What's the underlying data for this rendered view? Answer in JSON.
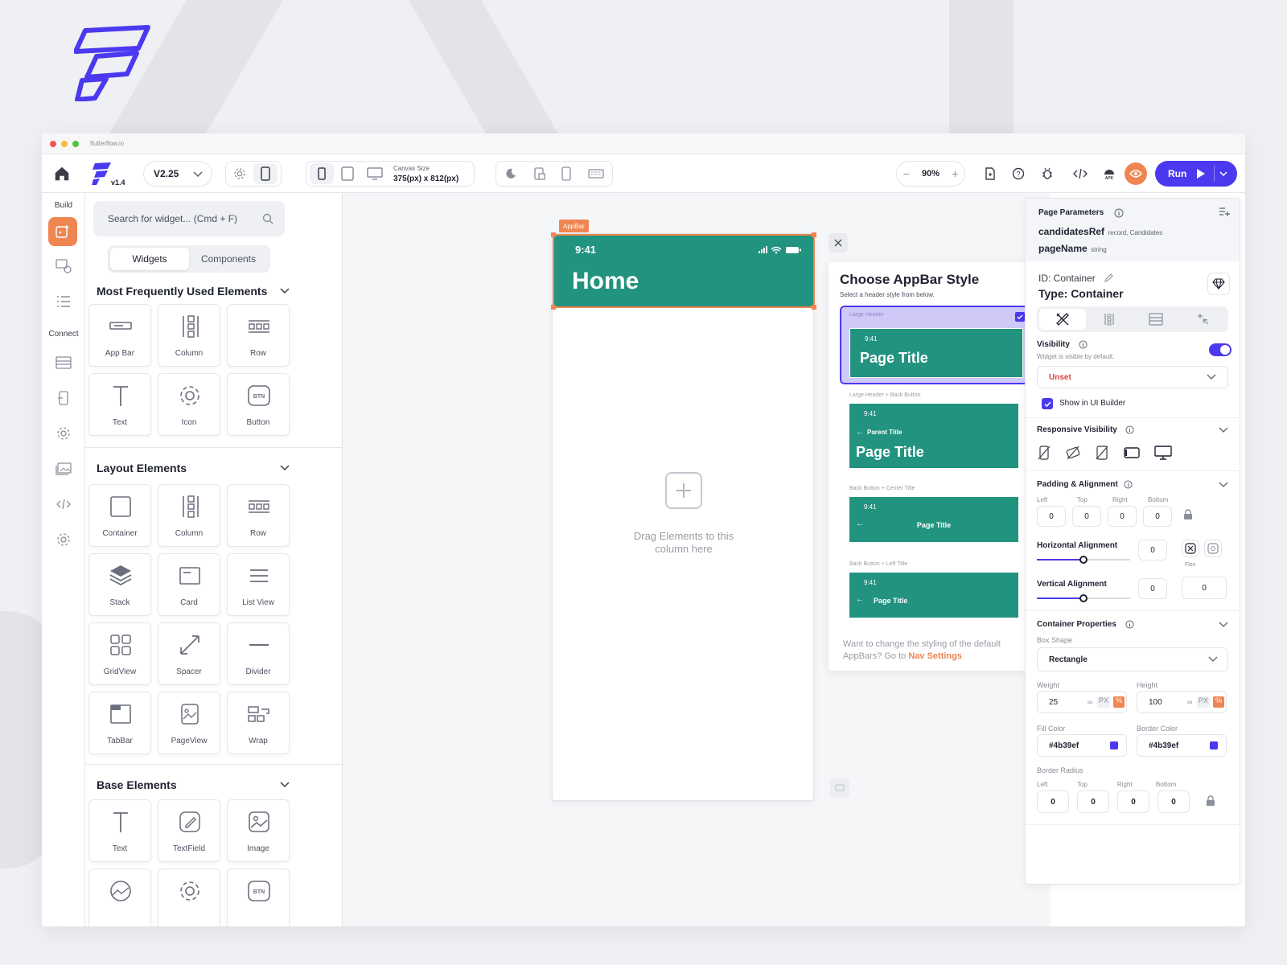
{
  "colors": {
    "brand": "#4b39ef",
    "accent": "#ef8551",
    "appbar": "#22937f",
    "selected_option": "#cfc9f7"
  },
  "browser": {
    "url": "flutterflow.io"
  },
  "toolbar": {
    "logo_version": "v1.4",
    "version": "V2.25",
    "canvas_size_label": "Canvas Size",
    "canvas_size_value": "375(px) x 812(px)",
    "zoom": "90%",
    "run_label": "Run"
  },
  "left_rail": {
    "build_label": "Build",
    "connect_label": "Connect"
  },
  "widget_panel": {
    "search_placeholder": "Search for widget... (Cmd + F)",
    "tabs": [
      "Widgets",
      "Components"
    ],
    "sections": [
      {
        "title": "Most Frequently Used Elements",
        "items": [
          "App Bar",
          "Column",
          "Row",
          "Text",
          "Icon",
          "Button"
        ]
      },
      {
        "title": "Layout Elements",
        "items": [
          "Container",
          "Column",
          "Row",
          "Stack",
          "Card",
          "List View",
          "GridView",
          "Spacer",
          "Divider",
          "TabBar",
          "PageView",
          "Wrap"
        ]
      },
      {
        "title": "Base Elements",
        "items": [
          "Text",
          "TextField",
          "Image"
        ]
      }
    ],
    "button_icon_text": "BTN"
  },
  "canvas": {
    "appbar_tag": "AppBar",
    "status_time": "9:41",
    "page_title": "Home",
    "drag_hint": "Drag Elements to this column here"
  },
  "appbar_chooser": {
    "title": "Choose AppBar Style",
    "subtitle": "Select a header style from below.",
    "options": [
      {
        "label": "Large Header",
        "time": "9:41",
        "title": "Page Title"
      },
      {
        "label": "Large Header + Back Button",
        "time": "9:41",
        "parent": "Parent Title",
        "title": "Page Title"
      },
      {
        "label": "Back Button + Center Title",
        "time": "9:41",
        "title": "Page Title"
      },
      {
        "label": "Back Button + Left Title",
        "time": "9:41",
        "title": "Page Title"
      }
    ],
    "footer_text": "Want to change the styling of the default AppBars? Go to",
    "footer_link": "Nav Settings"
  },
  "properties": {
    "page_params_title": "Page Parameters",
    "params": [
      {
        "name": "candidatesRef",
        "type": "record, Candidates"
      },
      {
        "name": "pageName",
        "type": "string"
      }
    ],
    "id_label": "ID: Container",
    "type_label": "Type: Container",
    "visibility_label": "Visibility",
    "visibility_hint": "Widget is visible by default.",
    "visibility_select": "Unset",
    "show_in_ui_builder": "Show in UI Builder",
    "responsive_visibility": "Responsive Visibility",
    "padding_title": "Padding & Alignment",
    "padding_labels": [
      "Left",
      "Top",
      "Right",
      "Bottom"
    ],
    "padding_values": [
      "0",
      "0",
      "0",
      "0"
    ],
    "horizontal_alignment": "Horizontal Alignment",
    "horizontal_value": "0",
    "flex_label": "Flex",
    "vertical_alignment": "Vertical Alignment",
    "vertical_value": "0",
    "flex_value": "0",
    "h_align_level": 0.5,
    "v_align_level": 0.5,
    "container_props_title": "Container Properties",
    "box_shape_label": "Box Shape",
    "box_shape_value": "Rectangle",
    "width_label": "Weight",
    "width_value": "25",
    "height_label": "Height",
    "height_value": "100",
    "unit_px": "PX",
    "unit_pct": "%",
    "infinity": "∞",
    "fill_color_label": "Fill Color",
    "fill_color_value": "#4b39ef",
    "border_color_label": "Border Color",
    "border_color_value": "#4b39ef",
    "border_radius_label": "Border Radius",
    "radius_labels": [
      "Left",
      "Top",
      "Right",
      "Bottom"
    ],
    "radius_values": [
      "0",
      "0",
      "0",
      "0"
    ]
  }
}
